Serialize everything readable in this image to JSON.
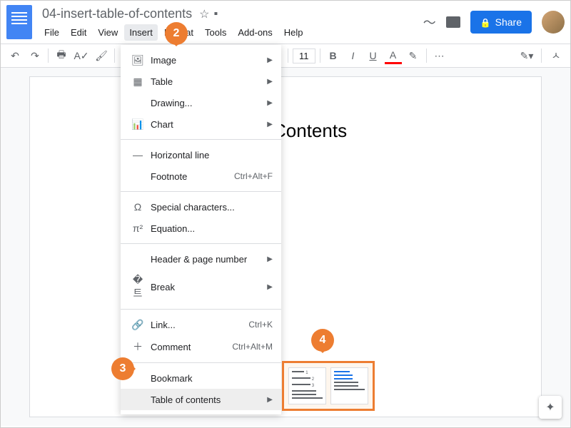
{
  "doc_title": "04-insert-table-of-contents",
  "menubar": [
    "File",
    "Edit",
    "View",
    "Insert",
    "Format",
    "Tools",
    "Add-ons",
    "Help"
  ],
  "share_label": "Share",
  "font_size": "11",
  "page_heading": "Contents",
  "insert_menu": [
    {
      "icon": "🖼",
      "label": "Image",
      "submenu": true
    },
    {
      "icon": "▦",
      "label": "Table",
      "submenu": true
    },
    {
      "icon": "",
      "label": "Drawing...",
      "submenu": true
    },
    {
      "icon": "📊",
      "label": "Chart",
      "submenu": true
    },
    {
      "sep": true
    },
    {
      "icon": "—",
      "label": "Horizontal line"
    },
    {
      "icon": "",
      "label": "Footnote",
      "shortcut": "Ctrl+Alt+F"
    },
    {
      "sep": true
    },
    {
      "icon": "Ω",
      "label": "Special characters..."
    },
    {
      "icon": "π²",
      "label": "Equation..."
    },
    {
      "sep": true
    },
    {
      "icon": "",
      "label": "Header & page number",
      "submenu": true
    },
    {
      "icon": "�트",
      "label": "Break",
      "submenu": true
    },
    {
      "sep": true
    },
    {
      "icon": "🔗",
      "label": "Link...",
      "shortcut": "Ctrl+K"
    },
    {
      "icon": "＋",
      "label": "Comment",
      "shortcut": "Ctrl+Alt+M"
    },
    {
      "sep": true
    },
    {
      "icon": "",
      "label": "Bookmark"
    },
    {
      "icon": "",
      "label": "Table of contents",
      "submenu": true,
      "highlight": true
    }
  ],
  "callouts": {
    "c2": "2",
    "c3": "3",
    "c4": "4"
  }
}
